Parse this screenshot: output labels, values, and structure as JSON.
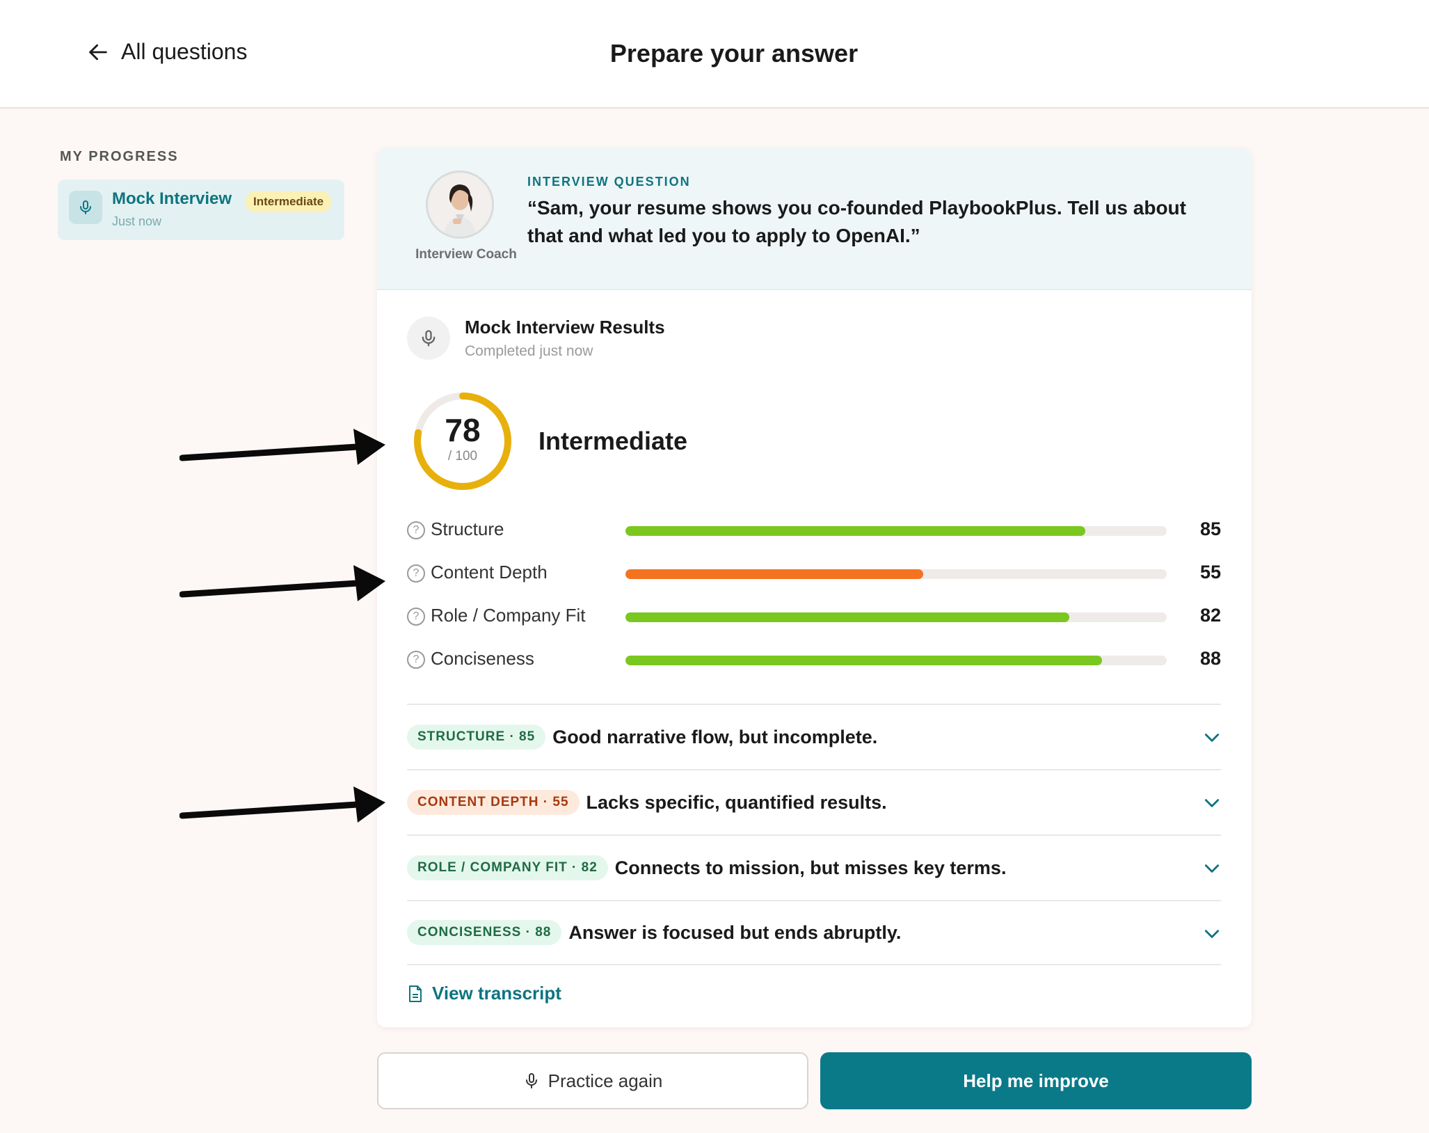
{
  "header": {
    "back_label": "All questions",
    "title": "Prepare your answer"
  },
  "sidebar": {
    "section_label": "MY PROGRESS",
    "item": {
      "title": "Mock Interview",
      "subtitle": "Just now",
      "badge": "Intermediate",
      "icon": "microphone-icon"
    }
  },
  "question": {
    "coach_label": "Interview Coach",
    "label": "INTERVIEW QUESTION",
    "text": "“Sam, your resume shows you co-founded PlaybookPlus. Tell us about that and what led you to apply to OpenAI.”"
  },
  "results": {
    "title": "Mock Interview Results",
    "subtitle": "Completed just now",
    "score": "78",
    "score_max": "/ 100",
    "score_value": 78,
    "level": "Intermediate",
    "metrics": [
      {
        "label": "Structure",
        "score": "85",
        "value": 85,
        "color": "#7ac81f"
      },
      {
        "label": "Content Depth",
        "score": "55",
        "value": 55,
        "color": "#f47320"
      },
      {
        "label": "Role / Company Fit",
        "score": "82",
        "value": 82,
        "color": "#7ac81f"
      },
      {
        "label": "Conciseness",
        "score": "88",
        "value": 88,
        "color": "#7ac81f"
      }
    ],
    "feedback": [
      {
        "tag": "STRUCTURE · 85",
        "text": "Good narrative flow, but incomplete.",
        "tone": "good"
      },
      {
        "tag": "CONTENT DEPTH · 55",
        "text": "Lacks specific, quantified results.",
        "tone": "warn"
      },
      {
        "tag": "ROLE / COMPANY FIT · 82",
        "text": "Connects to mission, but misses key terms.",
        "tone": "good"
      },
      {
        "tag": "CONCISENESS · 88",
        "text": "Answer is focused but ends abruptly.",
        "tone": "good"
      }
    ],
    "transcript_label": "View transcript"
  },
  "actions": {
    "practice_label": "Practice again",
    "help_label": "Help me improve"
  },
  "colors": {
    "accent": "#0a7a89",
    "gauge": "#e8b00c",
    "good": "#7ac81f",
    "warn": "#f47320"
  }
}
